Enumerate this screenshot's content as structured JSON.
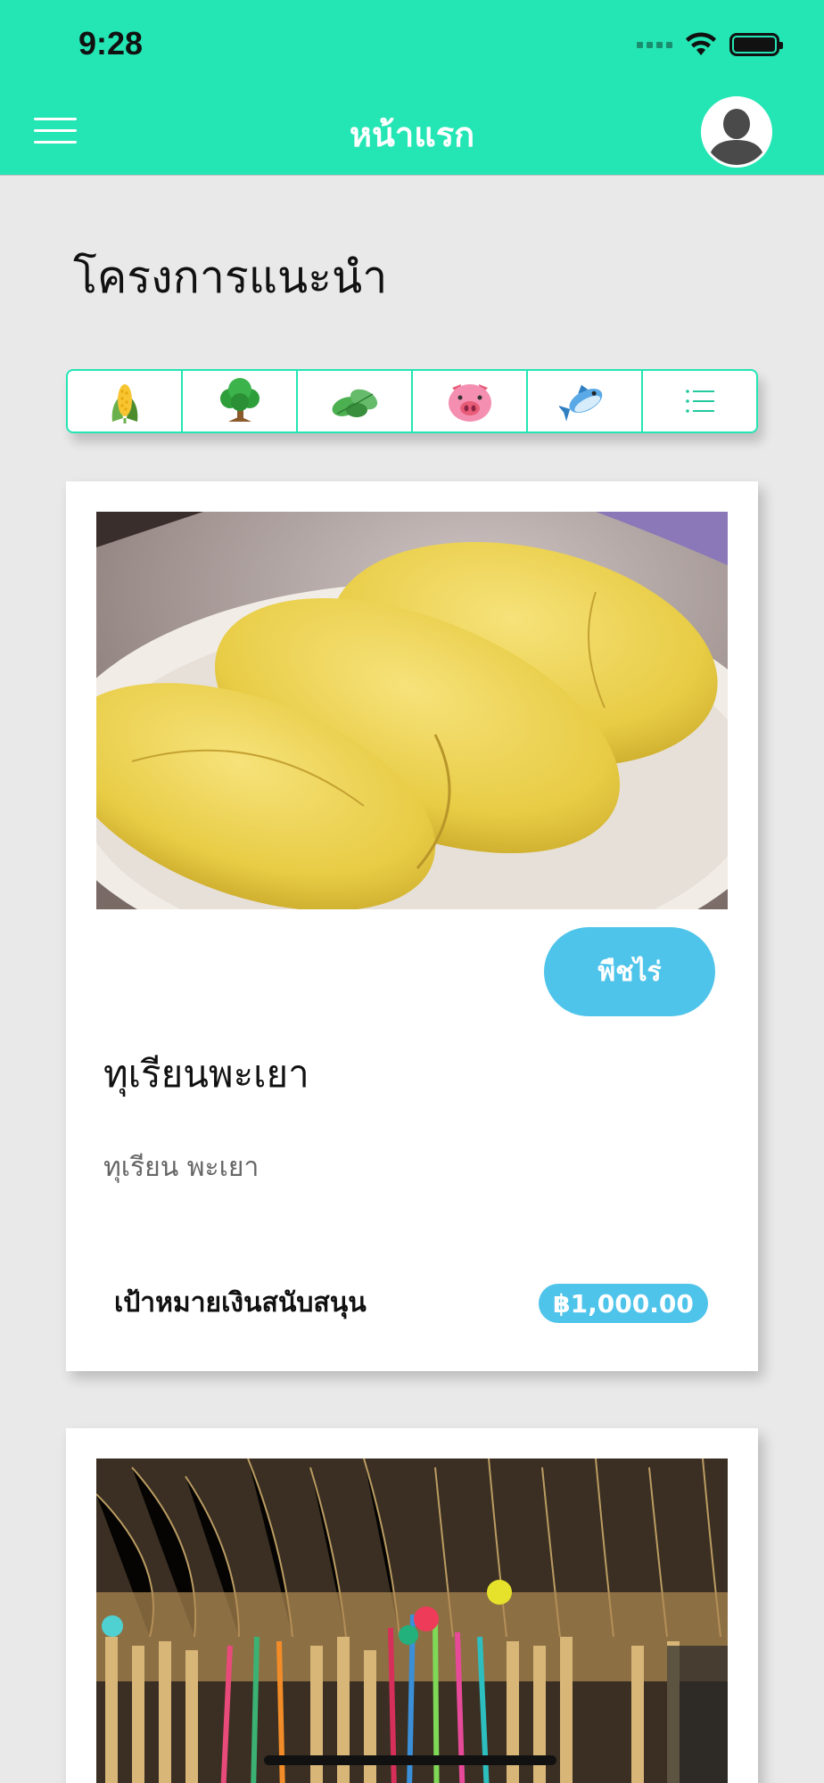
{
  "status_bar": {
    "time": "9:28"
  },
  "header": {
    "title": "หน้าแรก",
    "menu_icon": "hamburger-menu-icon",
    "avatar_icon": "user-avatar-icon",
    "background_color": "#24e5b4"
  },
  "section": {
    "title": "โครงการแนะนำ"
  },
  "categories": [
    {
      "icon": "corn-icon"
    },
    {
      "icon": "tree-icon"
    },
    {
      "icon": "herb-leaf-icon"
    },
    {
      "icon": "pig-icon"
    },
    {
      "icon": "fish-icon"
    },
    {
      "icon": "list-icon"
    }
  ],
  "projects": [
    {
      "image": "durian-photo",
      "category": "พืชไร่",
      "title": "ทุเรียนพะเยา",
      "description": "ทุเรียน พะเยา",
      "goal_label": "เป้าหมายเงินสนับสนุน",
      "goal_amount": "฿1,000.00"
    },
    {
      "image": "brooms-photo"
    }
  ],
  "colors": {
    "accent": "#24e5b4",
    "badge": "#4fc4ea"
  }
}
